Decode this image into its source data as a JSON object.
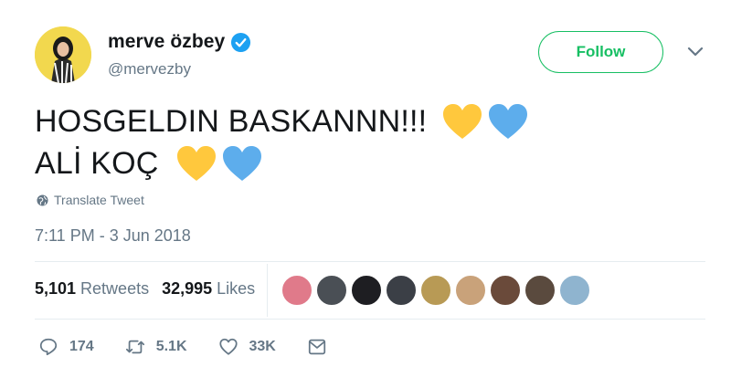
{
  "user": {
    "display_name": "merve özbey",
    "handle": "@mervezby",
    "verified": true
  },
  "follow_button": {
    "label": "Follow"
  },
  "tweet": {
    "lines": [
      "HOSGELDIN BASKANNN!!!",
      "ALİ KOÇ"
    ],
    "hearts": [
      "yellow-heart-icon",
      "blue-heart-icon"
    ],
    "translate_label": "Translate Tweet",
    "timestamp": "7:11 PM - 3 Jun 2018"
  },
  "stats": {
    "retweets_count": "5,101",
    "retweets_label": "Retweets",
    "likes_count": "32,995",
    "likes_label": "Likes"
  },
  "liker_avatars": [
    "#e07a8a",
    "#4a4f55",
    "#1e1e22",
    "#3b3f46",
    "#b89a55",
    "#c9a27a",
    "#6a4a3a",
    "#5a4a3e",
    "#8fb4cf"
  ],
  "actions": {
    "replies": "174",
    "retweets": "5.1K",
    "likes": "33K"
  },
  "colors": {
    "follow_green": "#17bf63",
    "verified_blue": "#1da1f2",
    "muted_text": "#657786",
    "heart_yellow": "#ffc83d",
    "heart_blue": "#5dadec"
  }
}
